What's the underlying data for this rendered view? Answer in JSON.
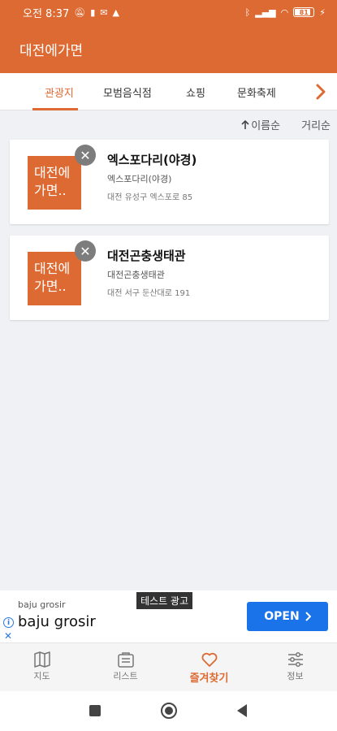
{
  "status_bar": {
    "time": "오전 8:37"
  },
  "app_bar": {
    "title": "대전에가면"
  },
  "tabs": [
    {
      "label": "관광지",
      "active": true
    },
    {
      "label": "모범음식점",
      "active": false
    },
    {
      "label": "쇼핑",
      "active": false
    },
    {
      "label": "문화축제",
      "active": false
    }
  ],
  "sort": {
    "by_name": "이름순",
    "by_distance": "거리순"
  },
  "favorites": [
    {
      "title": "엑스포다리(야경)",
      "subtitle": "엑스포다리(야경)",
      "address": "대전 유성구 엑스포로 85",
      "thumb_line1": "대전에",
      "thumb_line2": "가면.."
    },
    {
      "title": "대전곤충생태관",
      "subtitle": "대전곤충생태관",
      "address": "대전 서구 둔산대로 191",
      "thumb_line1": "대전에",
      "thumb_line2": "가면.."
    }
  ],
  "ad": {
    "badge": "테스트 광고",
    "advertiser_small": "baju grosir",
    "advertiser_big": "baju grosir",
    "cta": "OPEN"
  },
  "bottom_nav": [
    {
      "label": "지도",
      "icon": "map-icon",
      "active": false
    },
    {
      "label": "리스트",
      "icon": "list-icon",
      "active": false
    },
    {
      "label": "즐겨찾기",
      "icon": "heart-icon",
      "active": true
    },
    {
      "label": "정보",
      "icon": "settings-sliders-icon",
      "active": false
    }
  ],
  "colors": {
    "accent": "#dd6a32",
    "background": "#eff1f4",
    "ad_button": "#1a73e8"
  }
}
